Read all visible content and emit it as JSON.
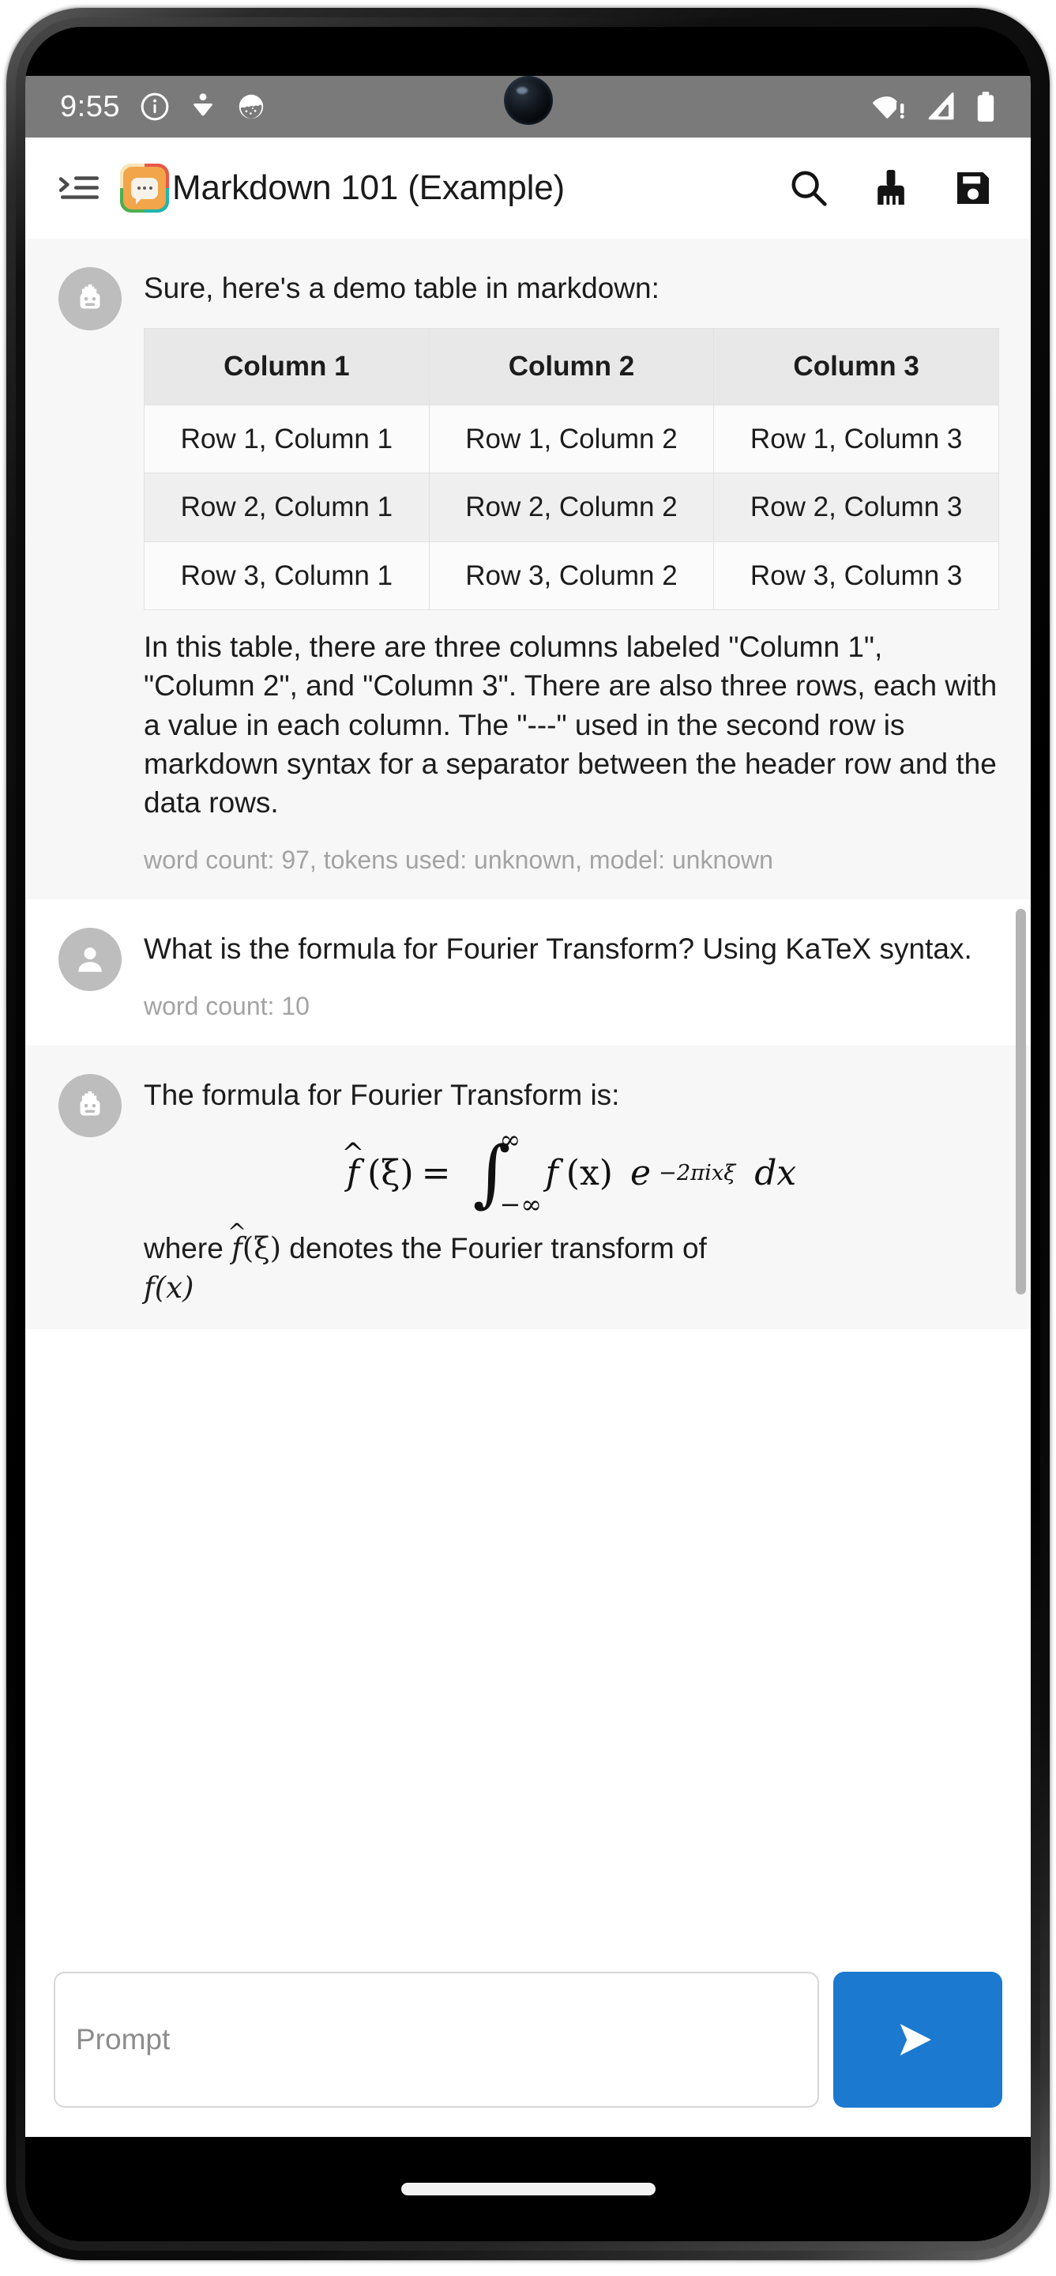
{
  "status_bar": {
    "time": "9:55",
    "left_icons": [
      "info-icon",
      "download-icon",
      "app-notification-icon"
    ],
    "right_icons": [
      "wifi-warning-icon",
      "cellular-signal-icon",
      "battery-full-icon"
    ]
  },
  "app_bar": {
    "menu_icon": "menu-open-icon",
    "app_icon": "markdown-chat-app-icon",
    "title": "Markdown 101 (Example)",
    "actions": [
      {
        "name": "search-button",
        "icon": "search-icon"
      },
      {
        "name": "clear-button",
        "icon": "broom-icon"
      },
      {
        "name": "save-button",
        "icon": "floppy-save-icon"
      }
    ]
  },
  "messages": [
    {
      "role": "assistant",
      "avatar_icon": "robot-avatar-icon",
      "intro": "Sure, here's a demo table in markdown:",
      "table": {
        "headers": [
          "Column 1",
          "Column 2",
          "Column 3"
        ],
        "rows": [
          [
            "Row 1, Column 1",
            "Row 1, Column 2",
            "Row 1, Column 3"
          ],
          [
            "Row 2, Column 1",
            "Row 2, Column 2",
            "Row 2, Column 3"
          ],
          [
            "Row 3, Column 1",
            "Row 3, Column 2",
            "Row 3, Column 3"
          ]
        ]
      },
      "explanation": "In this table, there are three columns labeled \"Column 1\", \"Column 2\", and \"Column 3\". There are also three rows, each with a value in each column. The \"---\" used in the second row is markdown syntax for a separator between the header row and the data rows.",
      "meta": "word count: 97, tokens used: unknown, model: unknown"
    },
    {
      "role": "user",
      "avatar_icon": "person-avatar-icon",
      "text": "What is the formula for Fourier Transform? Using KaTeX syntax.",
      "meta": "word count: 10"
    },
    {
      "role": "assistant",
      "avatar_icon": "robot-avatar-icon",
      "intro": "The formula for Fourier Transform is:",
      "formula": {
        "lhs_fn": "f",
        "lhs_hat": "^",
        "lhs_arg": "(ξ)",
        "equals": "=",
        "integral": "∫",
        "upper_limit": "∞",
        "lower_limit": "−∞",
        "integrand_fn": "f",
        "integrand_arg": "(x)",
        "exp_base": "e",
        "exp_power": "−2πixξ",
        "differential": "dx"
      },
      "trailing_prefix": "where ",
      "trailing_fn": "f",
      "trailing_hat": "^",
      "trailing_arg": "(ξ)",
      "trailing_suffix": " denotes the Fourier transform of",
      "trailing_clipped": "f(x)"
    }
  ],
  "scroll_controls": {
    "up_icon": "arrow-up-circle-icon",
    "down_icon": "arrow-down-circle-icon"
  },
  "input_bar": {
    "placeholder": "Prompt",
    "value": "",
    "send_icon": "send-arrow-icon"
  },
  "colors": {
    "send_button": "#1b79d0",
    "assistant_bubble": "#f7f7f7",
    "status_bar": "#7a7a7a",
    "table_header": "#e8e8e8",
    "meta_text": "#a3a3a3"
  }
}
